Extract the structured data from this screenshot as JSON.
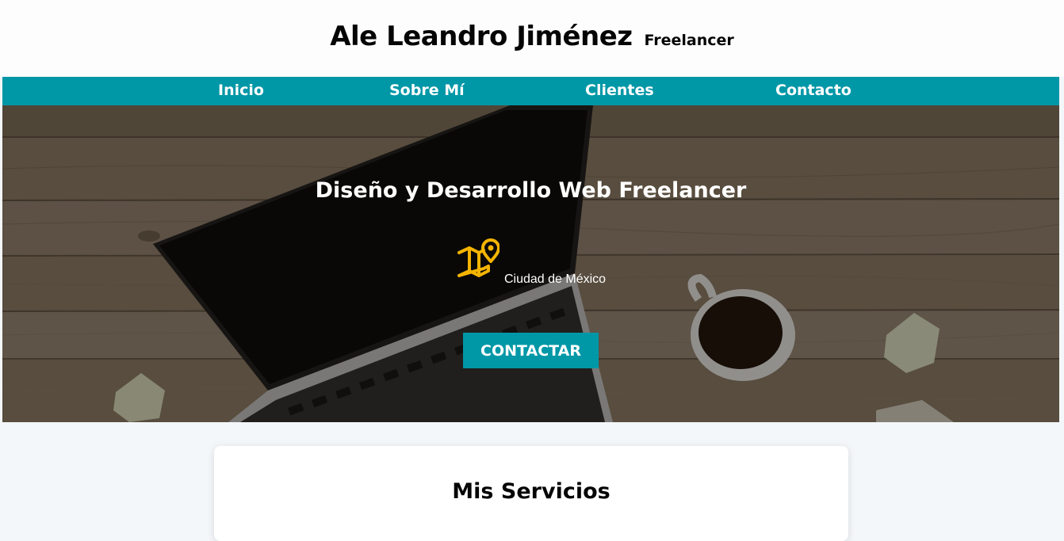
{
  "header": {
    "name": "Ale Leandro Jiménez",
    "tagline": "Freelancer"
  },
  "nav": {
    "items": [
      {
        "label": "Inicio"
      },
      {
        "label": "Sobre Mí"
      },
      {
        "label": "Clientes"
      },
      {
        "label": "Contacto"
      }
    ],
    "background": "#0097a7"
  },
  "hero": {
    "title": "Diseño y Desarrollo Web Freelancer",
    "location": "Ciudad de México",
    "location_icon": "map-location-icon",
    "cta_label": "CONTACTAR",
    "icon_color": "#f4b400"
  },
  "services": {
    "title": "Mis Servicios"
  },
  "colors": {
    "accent": "#0097a7",
    "page_background": "#f4f7fa",
    "text": "#050505"
  }
}
